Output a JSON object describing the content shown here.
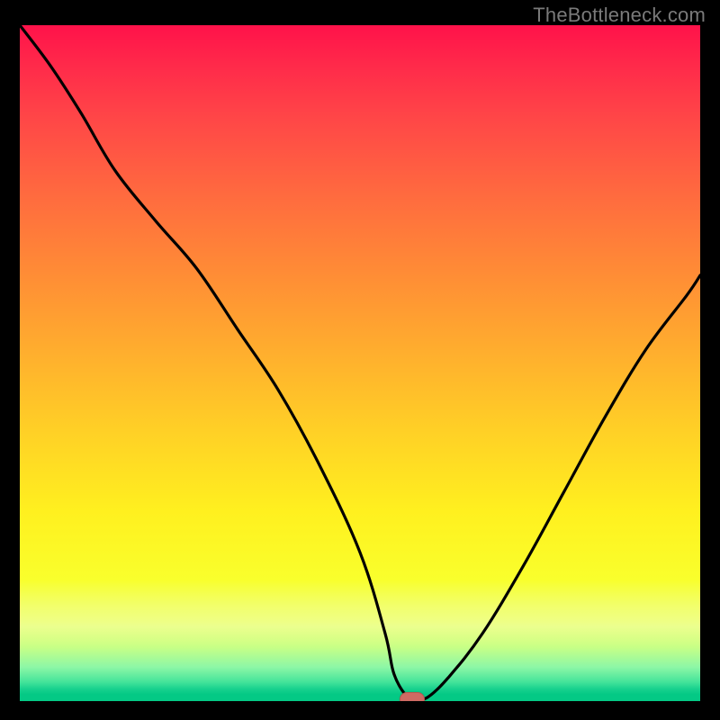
{
  "watermark": "TheBottleneck.com",
  "colors": {
    "frame": "#000000",
    "curve": "#000000",
    "marker": "#cf6a63"
  },
  "chart_data": {
    "type": "line",
    "title": "",
    "xlabel": "",
    "ylabel": "",
    "xlim": [
      0,
      100
    ],
    "ylim": [
      0,
      100
    ],
    "grid": false,
    "legend": false,
    "series": [
      {
        "name": "bottleneck-curve",
        "x": [
          0,
          4.5,
          9,
          14,
          20,
          26,
          32,
          38,
          44,
          50,
          53.7,
          55,
          57,
          58.5,
          60,
          63,
          68,
          74,
          80,
          86,
          92,
          98,
          100
        ],
        "y": [
          100,
          94,
          87,
          78.5,
          71,
          64,
          55,
          46,
          35,
          22,
          10,
          4,
          0.6,
          0.4,
          0.6,
          3.5,
          10,
          20,
          31,
          42,
          52,
          60,
          63
        ]
      }
    ],
    "annotations": [
      {
        "name": "optimum-marker",
        "x": 57.5,
        "y": 0.4,
        "shape": "pill",
        "color": "#cf6a63"
      }
    ],
    "background": {
      "type": "vertical-gradient",
      "stops": [
        {
          "pos": 0.0,
          "color": "#ff124a"
        },
        {
          "pos": 0.25,
          "color": "#ff6a3f"
        },
        {
          "pos": 0.5,
          "color": "#ffb02c"
        },
        {
          "pos": 0.72,
          "color": "#fff01f"
        },
        {
          "pos": 0.88,
          "color": "#e8ff5a"
        },
        {
          "pos": 0.97,
          "color": "#43e39a"
        },
        {
          "pos": 1.0,
          "color": "#04c985"
        }
      ]
    }
  }
}
